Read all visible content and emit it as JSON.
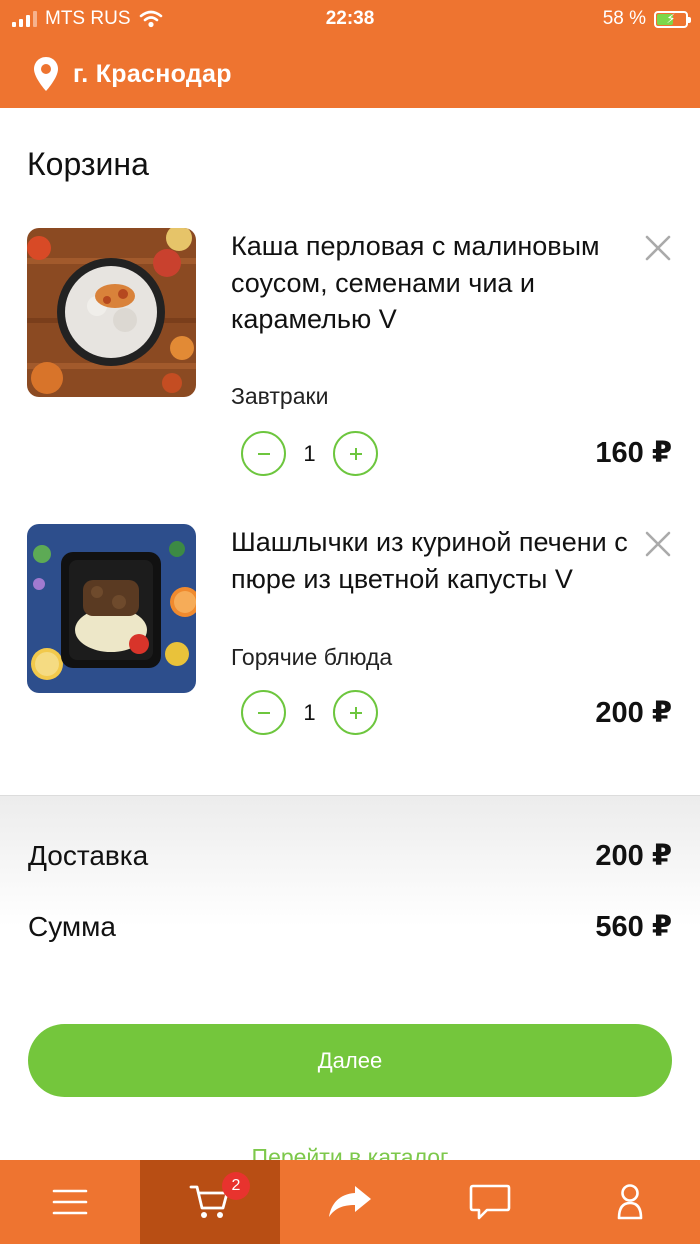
{
  "status_bar": {
    "carrier": "MTS RUS",
    "time": "22:38",
    "battery_percent": "58 %",
    "battery_level": 0.58
  },
  "header": {
    "city": "г. Краснодар",
    "location_icon": "map-pin-icon"
  },
  "page": {
    "title": "Корзина"
  },
  "cart": {
    "items": [
      {
        "title": "Каша перловая с малиновым соусом, семенами чиа и карамелью V",
        "category": "Завтраки",
        "quantity": "1",
        "price": "160 ₽"
      },
      {
        "title": "Шашлычки из куриной печени с пюре из цветной капусты V",
        "category": "Горячие блюда",
        "quantity": "1",
        "price": "200 ₽"
      }
    ]
  },
  "totals": {
    "delivery_label": "Доставка",
    "delivery_value": "200 ₽",
    "sum_label": "Сумма",
    "sum_value": "560 ₽"
  },
  "actions": {
    "next_label": "Далее",
    "catalog_label": "Перейти в каталог"
  },
  "tabbar": {
    "items": [
      {
        "icon": "menu-icon"
      },
      {
        "icon": "cart-icon",
        "badge": "2"
      },
      {
        "icon": "share-arrow-icon"
      },
      {
        "icon": "chat-icon"
      },
      {
        "icon": "user-icon"
      }
    ]
  },
  "colors": {
    "brand_orange": "#EE7430",
    "active_tab": "#B84E14",
    "accent_green": "#74C63C",
    "badge_red": "#E8332E"
  }
}
